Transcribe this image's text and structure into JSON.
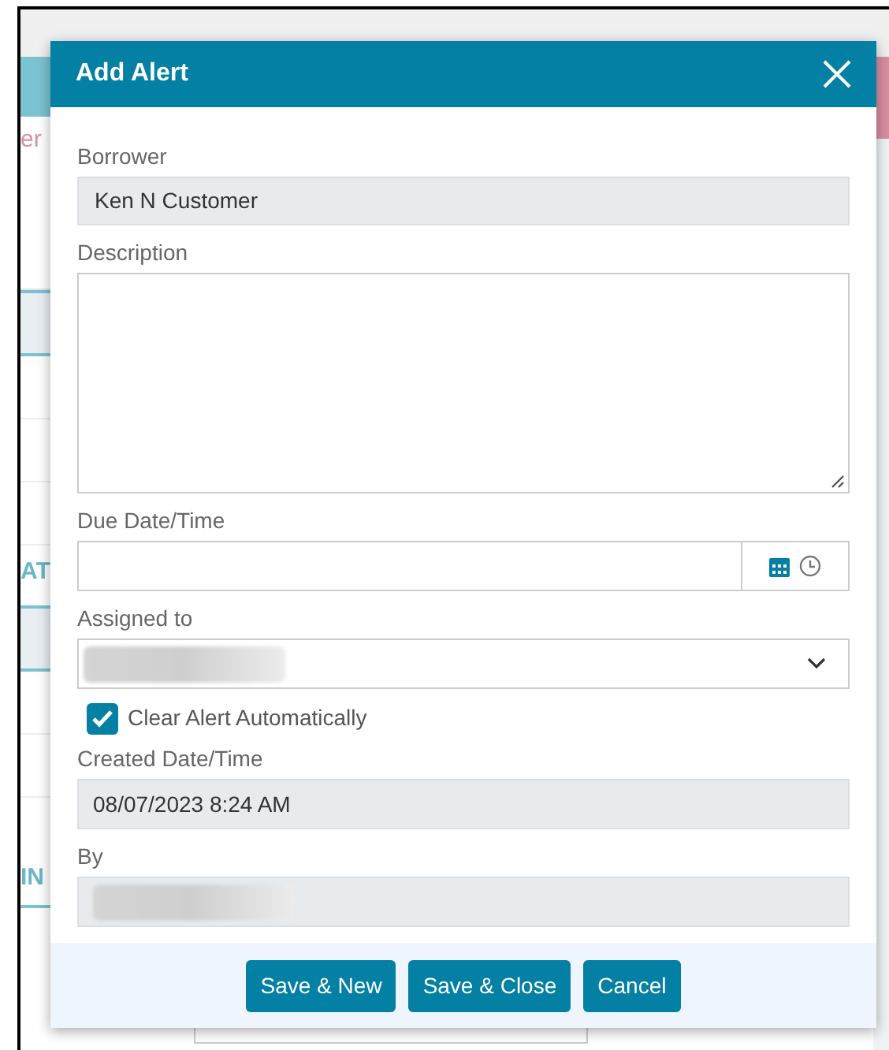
{
  "background": {
    "left_fragments": [
      "er",
      "AT",
      "IN"
    ]
  },
  "dialog": {
    "title": "Add Alert",
    "borrower": {
      "label": "Borrower",
      "value": "Ken N Customer"
    },
    "description": {
      "label": "Description"
    },
    "due": {
      "label": "Due Date/Time"
    },
    "assigned": {
      "label": "Assigned to"
    },
    "clear_auto": {
      "label": "Clear Alert Automatically",
      "checked": true
    },
    "created": {
      "label": "Created Date/Time",
      "value": "08/07/2023 8:24 AM"
    },
    "by": {
      "label": "By"
    },
    "buttons": [
      "Save & New",
      "Save & Close",
      "Cancel"
    ]
  }
}
